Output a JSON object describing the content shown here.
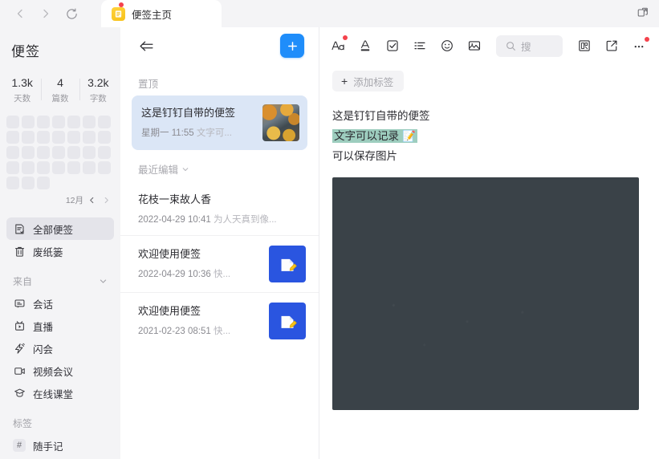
{
  "titlebar": {
    "back_label": "back-arrow",
    "forward_label": "forward-arrow",
    "refresh_label": "refresh",
    "tab_title": "便签主页",
    "popout_label": "popout"
  },
  "sidebar": {
    "title": "便签",
    "stats": [
      {
        "value": "1.3k",
        "label": "天数"
      },
      {
        "value": "4",
        "label": "篇数"
      },
      {
        "value": "3.2k",
        "label": "字数"
      }
    ],
    "heatmap": {
      "columns": 7,
      "days": 31,
      "month_label": "12月"
    },
    "primary_items": [
      {
        "label": "全部便签",
        "icon": "note-list-icon",
        "active": true
      },
      {
        "label": "废纸篓",
        "icon": "trash-icon",
        "active": false
      }
    ],
    "source_group": {
      "label": "来自"
    },
    "source_items": [
      {
        "label": "会话",
        "icon": "chat-icon"
      },
      {
        "label": "直播",
        "icon": "live-icon"
      },
      {
        "label": "闪会",
        "icon": "flash-meeting-icon"
      },
      {
        "label": "视频会议",
        "icon": "video-meeting-icon"
      },
      {
        "label": "在线课堂",
        "icon": "online-class-icon"
      }
    ],
    "tag_group": {
      "label": "标签"
    },
    "tag_items": [
      {
        "label": "随手记",
        "icon": "hash-icon"
      }
    ]
  },
  "list_panel": {
    "collapse_label": "collapse-panel",
    "add_label": "new-note",
    "pinned_section": "置顶",
    "recent_section": "最近编辑",
    "pinned_notes": [
      {
        "title": "这是钉钉自带的便签",
        "time": "星期一  11:55",
        "preview": "文字可...",
        "thumb": "leaves",
        "selected": true
      }
    ],
    "recent_notes": [
      {
        "title": "花枝一束故人香",
        "time": "2022-04-29 10:41",
        "preview": "为人天真到像...",
        "thumb": "none",
        "selected": false
      },
      {
        "title": "欢迎使用便签",
        "time": "2022-04-29 10:36",
        "preview": "快...",
        "thumb": "blue-note",
        "selected": false
      },
      {
        "title": "欢迎使用便签",
        "time": "2021-02-23 08:51",
        "preview": "快...",
        "thumb": "blue-note",
        "selected": false
      }
    ]
  },
  "editor": {
    "toolbar": [
      {
        "name": "font-style-icon",
        "label": "Aa",
        "badge": true
      },
      {
        "name": "text-color-icon",
        "label": "A",
        "badge": false
      },
      {
        "name": "checklist-icon",
        "label": "checkbox",
        "badge": false
      },
      {
        "name": "list-icon",
        "label": "list",
        "badge": false
      },
      {
        "name": "emoji-icon",
        "label": "emoji",
        "badge": false
      },
      {
        "name": "image-icon",
        "label": "image",
        "badge": false
      }
    ],
    "search_placeholder": "搜",
    "right_tools": [
      {
        "name": "sticker-icon",
        "label": "贴",
        "badge": false
      },
      {
        "name": "share-icon",
        "label": "share",
        "badge": false
      },
      {
        "name": "more-icon",
        "label": "•••",
        "badge": true
      }
    ],
    "add_tag_label": "添加标签",
    "lines": [
      {
        "text": "这是钉钉自带的便签",
        "highlight": false
      },
      {
        "text": "文字可以记录",
        "highlight": true,
        "suffix_icon": "memo-emoji"
      },
      {
        "text": "可以保存图片",
        "highlight": false
      }
    ],
    "image_alt": "autumn-leaves-on-asphalt"
  },
  "colors": {
    "accent_blue": "#1f8dfa",
    "selected_card": "#dbe6f6",
    "highlight_green": "#9dcdbe",
    "badge_red": "#f4424c",
    "tab_yellow": "#ffd23c"
  }
}
